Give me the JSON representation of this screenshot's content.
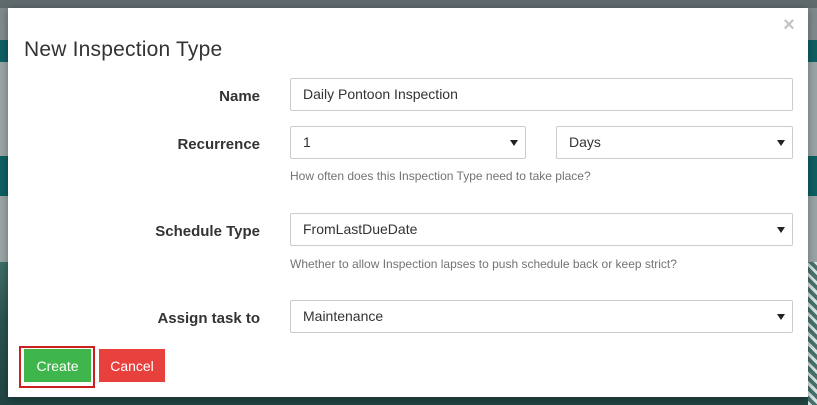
{
  "modal": {
    "title": "New Inspection Type",
    "close_symbol": "×"
  },
  "form": {
    "name": {
      "label": "Name",
      "value": "Daily Pontoon Inspection"
    },
    "recurrence": {
      "label": "Recurrence",
      "count_value": "1",
      "unit_value": "Days",
      "help": "How often does this Inspection Type need to take place?"
    },
    "schedule_type": {
      "label": "Schedule Type",
      "value": "FromLastDueDate",
      "help": "Whether to allow Inspection lapses to push schedule back or keep strict?"
    },
    "assign_task_to": {
      "label": "Assign task to",
      "value": "Maintenance"
    }
  },
  "buttons": {
    "create": "Create",
    "cancel": "Cancel"
  },
  "colors": {
    "create": "#3fb64b",
    "cancel": "#e8403d",
    "highlight": "#cc1f1f",
    "backdrop_teal": "#0e5f63"
  },
  "icons": {
    "close": "close-icon",
    "select_caret": "chevron-down-icon"
  }
}
